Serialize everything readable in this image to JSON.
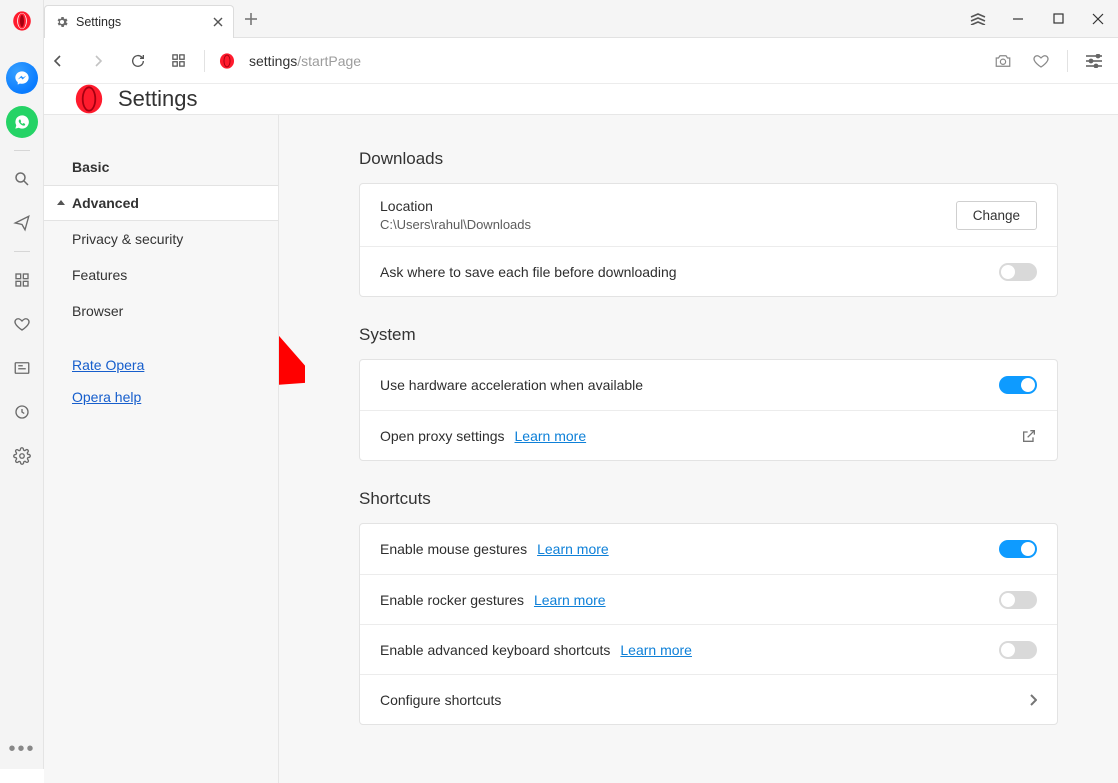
{
  "tab": {
    "title": "Settings"
  },
  "url": {
    "base": "settings",
    "rest": "/startPage"
  },
  "page": {
    "title": "Settings"
  },
  "sidebar": {
    "basic": "Basic",
    "advanced": "Advanced",
    "items": [
      "Privacy & security",
      "Features",
      "Browser"
    ],
    "rate": "Rate Opera",
    "help": "Opera help"
  },
  "downloads": {
    "heading": "Downloads",
    "location_label": "Location",
    "location_value": "C:\\Users\\rahul\\Downloads",
    "change": "Change",
    "ask": "Ask where to save each file before downloading"
  },
  "system": {
    "heading": "System",
    "hwaccel": "Use hardware acceleration when available",
    "proxy": "Open proxy settings",
    "learn": "Learn more"
  },
  "shortcuts": {
    "heading": "Shortcuts",
    "mouse": "Enable mouse gestures",
    "rocker": "Enable rocker gestures",
    "keyboard": "Enable advanced keyboard shortcuts",
    "configure": "Configure shortcuts",
    "learn": "Learn more"
  }
}
